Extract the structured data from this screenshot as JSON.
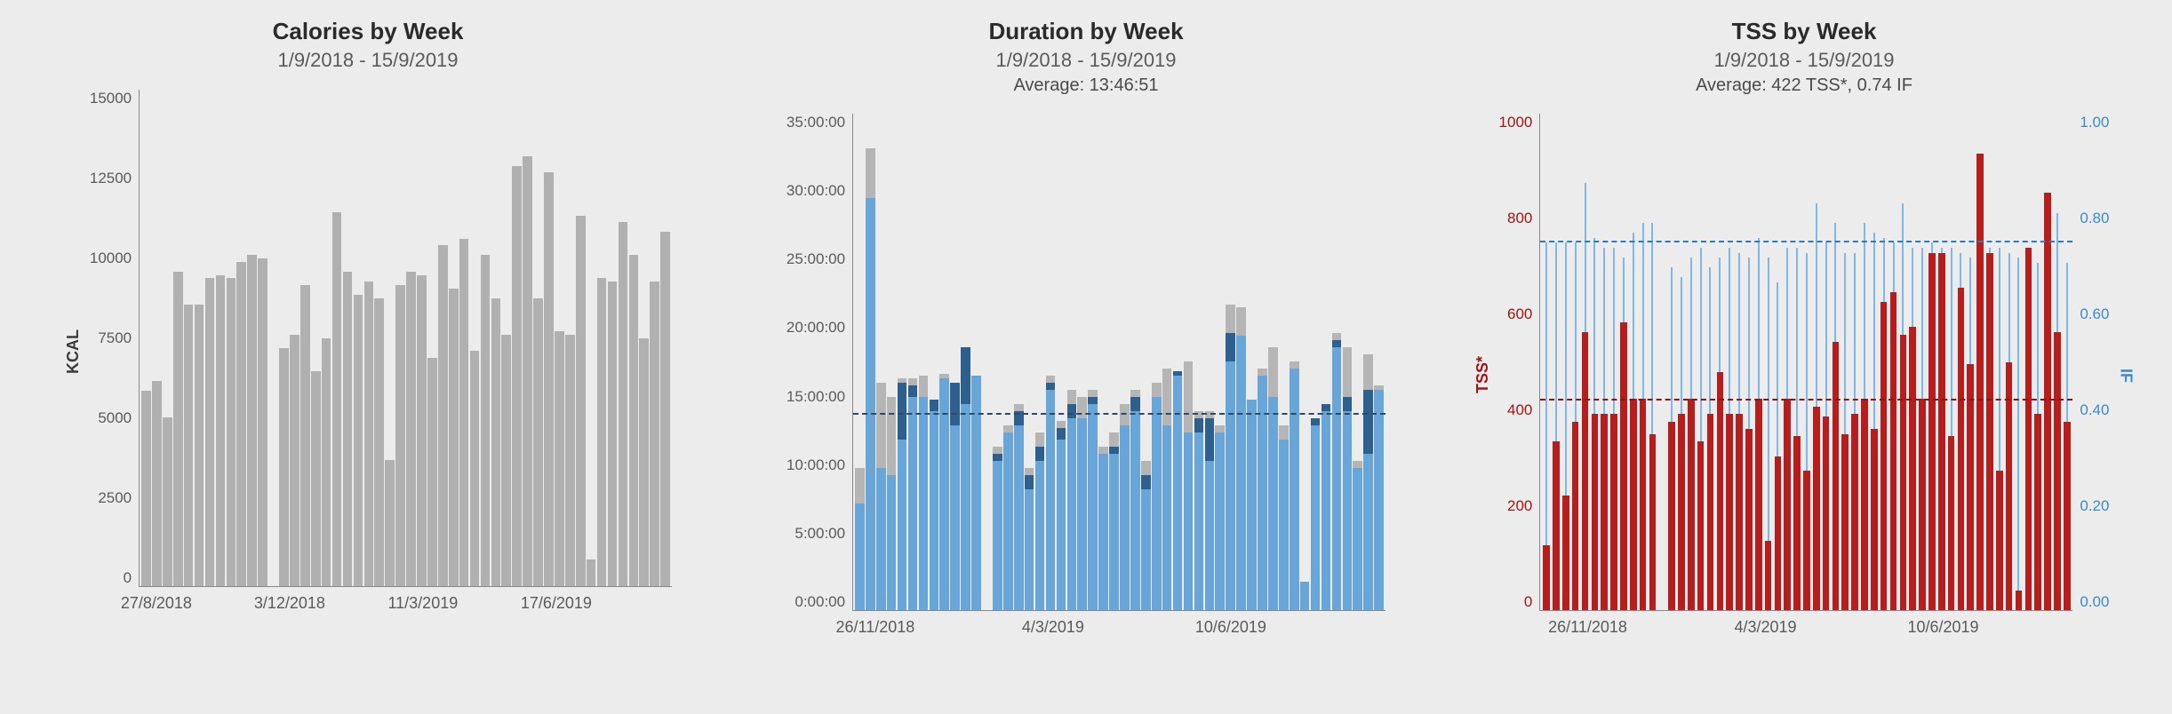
{
  "panels": {
    "calories": {
      "title": "Calories by Week",
      "subtitle": "1/9/2018 - 15/9/2019",
      "ylabel": "KCAL"
    },
    "duration": {
      "title": "Duration by Week",
      "subtitle": "1/9/2018 - 15/9/2019",
      "avg": "Average: 13:46:51"
    },
    "tss": {
      "title": "TSS by Week",
      "subtitle": "1/9/2018 - 15/9/2019",
      "avg": "Average: 422 TSS*, 0.74 IF",
      "ylabel_left": "TSS*",
      "ylabel_right": "IF"
    }
  },
  "chart_data": [
    {
      "id": "calories",
      "type": "bar",
      "title": "Calories by Week",
      "subtitle": "1/9/2018 - 15/9/2019",
      "ylabel": "KCAL",
      "ylim": [
        0,
        15000
      ],
      "yticks": [
        0,
        2500,
        5000,
        7500,
        10000,
        12500,
        15000
      ],
      "xticks": [
        "27/8/2018",
        "3/12/2018",
        "11/3/2019",
        "17/6/2019"
      ],
      "values": [
        5900,
        6200,
        5100,
        9500,
        8500,
        8500,
        9300,
        9400,
        9300,
        9800,
        10000,
        9900,
        0,
        7200,
        7600,
        9100,
        6500,
        7500,
        11300,
        9500,
        8800,
        9200,
        8700,
        3800,
        9100,
        9500,
        9400,
        6900,
        10300,
        9000,
        10500,
        7100,
        10000,
        8700,
        7600,
        12700,
        13000,
        8700,
        12500,
        7700,
        7600,
        11200,
        800,
        9300,
        9200,
        11000,
        10000,
        7500,
        9200,
        10700
      ]
    },
    {
      "id": "duration",
      "type": "bar",
      "title": "Duration by Week",
      "subtitle": "1/9/2018 - 15/9/2019",
      "average_label": "Average: 13:46:51",
      "average_seconds": 49611,
      "ylim_seconds": [
        0,
        126000
      ],
      "yticks": [
        "0:00:00",
        "5:00:00",
        "10:00:00",
        "15:00:00",
        "20:00:00",
        "25:00:00",
        "30:00:00",
        "35:00:00"
      ],
      "xticks": [
        "26/11/2018",
        "4/3/2019",
        "10/6/2019"
      ],
      "series_note": "each bar split into segments (hours): [lightblue, darkblue, gray]",
      "bars_hours": [
        [
          7.5,
          0,
          2.5
        ],
        [
          29.0,
          0,
          3.5
        ],
        [
          10.0,
          0,
          6.0
        ],
        [
          9.5,
          0,
          5.5
        ],
        [
          12.0,
          4.0,
          0.3
        ],
        [
          15.0,
          0.8,
          0.5
        ],
        [
          15.0,
          0,
          1.5
        ],
        [
          14.0,
          0.8,
          0
        ],
        [
          16.3,
          0,
          0.3
        ],
        [
          13.0,
          3.0,
          0
        ],
        [
          14.5,
          4.0,
          0
        ],
        [
          16.5,
          0,
          0
        ],
        [
          0,
          0,
          0
        ],
        [
          10.5,
          0.5,
          0.5
        ],
        [
          12.5,
          0,
          0.5
        ],
        [
          13.0,
          1.0,
          0.5
        ],
        [
          8.5,
          1.0,
          0.5
        ],
        [
          10.5,
          1.0,
          1.0
        ],
        [
          15.5,
          0.5,
          0.5
        ],
        [
          12.0,
          0.8,
          0.5
        ],
        [
          13.5,
          1.0,
          1.0
        ],
        [
          13.5,
          0,
          1.5
        ],
        [
          14.5,
          0.5,
          0.5
        ],
        [
          11.0,
          0,
          0.5
        ],
        [
          11.0,
          0.5,
          1.0
        ],
        [
          13.0,
          0,
          1.5
        ],
        [
          14.0,
          1.0,
          0.5
        ],
        [
          8.5,
          1.0,
          1.0
        ],
        [
          15.0,
          0,
          1.0
        ],
        [
          13.0,
          0,
          4.0
        ],
        [
          16.5,
          0.3,
          0
        ],
        [
          12.5,
          0,
          5.0
        ],
        [
          12.5,
          1.0,
          0.5
        ],
        [
          10.5,
          3.0,
          0.5
        ],
        [
          12.5,
          0,
          0.5
        ],
        [
          17.5,
          2.0,
          2.0
        ],
        [
          19.3,
          0,
          2.0
        ],
        [
          14.8,
          0,
          0
        ],
        [
          16.5,
          0,
          0.5
        ],
        [
          15.0,
          0,
          3.5
        ],
        [
          12.0,
          0,
          1.0
        ],
        [
          17.0,
          0,
          0.5
        ],
        [
          2.0,
          0,
          0
        ],
        [
          13.0,
          0.5,
          0
        ],
        [
          14.0,
          0.5,
          0
        ],
        [
          18.5,
          0.5,
          0.5
        ],
        [
          14.0,
          1.0,
          3.5
        ],
        [
          10.0,
          0,
          0.5
        ],
        [
          11.0,
          4.5,
          2.5
        ],
        [
          15.5,
          0,
          0.3
        ]
      ]
    },
    {
      "id": "tss",
      "type": "bar",
      "title": "TSS by Week",
      "subtitle": "1/9/2018 - 15/9/2019",
      "average_label": "Average: 422 TSS*, 0.74 IF",
      "tss_avg": 422,
      "if_avg": 0.74,
      "left_ylabel": "TSS*",
      "right_ylabel": "IF",
      "left_ylim": [
        0,
        1000
      ],
      "right_ylim": [
        0,
        1.0
      ],
      "left_yticks": [
        0,
        200,
        400,
        600,
        800,
        1000
      ],
      "right_yticks": [
        "0.00",
        "0.20",
        "0.40",
        "0.60",
        "0.80",
        "1.00"
      ],
      "xticks": [
        "26/11/2018",
        "4/3/2019",
        "10/6/2019"
      ],
      "tss_values": [
        130,
        340,
        230,
        380,
        560,
        395,
        395,
        395,
        580,
        425,
        425,
        355,
        0,
        380,
        395,
        425,
        340,
        395,
        480,
        395,
        395,
        365,
        425,
        140,
        310,
        425,
        350,
        280,
        410,
        390,
        540,
        355,
        395,
        425,
        365,
        620,
        640,
        555,
        570,
        425,
        720,
        720,
        350,
        650,
        495,
        920,
        720,
        280,
        500,
        40,
        730,
        395,
        840,
        560,
        380
      ],
      "if_values": [
        0.74,
        0.74,
        0.74,
        0.74,
        0.86,
        0.75,
        0.73,
        0.73,
        0.71,
        0.76,
        0.78,
        0.78,
        0,
        0.69,
        0.67,
        0.71,
        0.73,
        0.69,
        0.71,
        0.73,
        0.72,
        0.71,
        0.75,
        0.71,
        0.66,
        0.73,
        0.73,
        0.72,
        0.82,
        0.74,
        0.78,
        0.72,
        0.72,
        0.78,
        0.76,
        0.75,
        0.74,
        0.82,
        0.73,
        0.73,
        0.74,
        0.73,
        0.73,
        0.72,
        0.71,
        0.71,
        0.73,
        0.73,
        0.72,
        0.71,
        0.73,
        0.7,
        0.73,
        0.8,
        0.7
      ]
    }
  ]
}
